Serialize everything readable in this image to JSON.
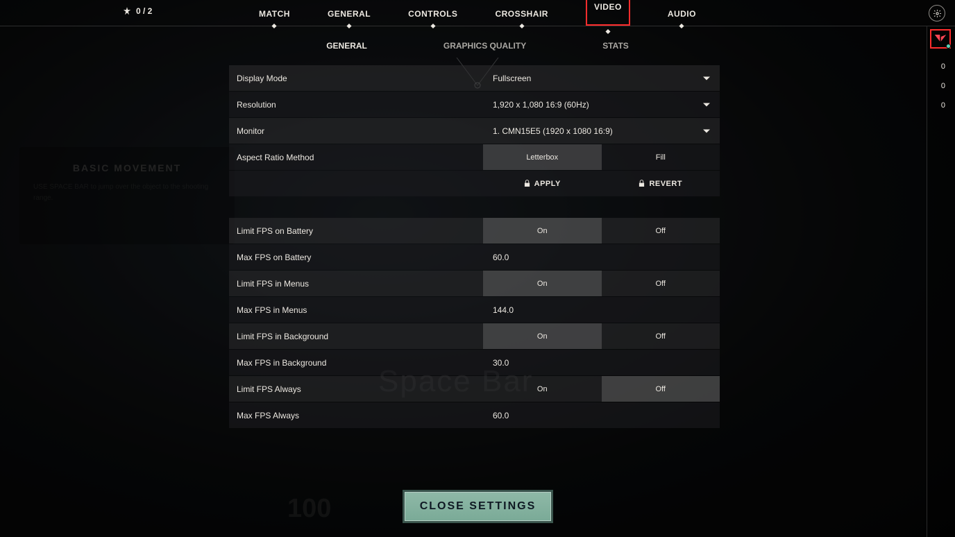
{
  "top": {
    "bolt_count": "0 / 2",
    "tabs": [
      "MATCH",
      "GENERAL",
      "CONTROLS",
      "CROSSHAIR",
      "VIDEO",
      "AUDIO"
    ],
    "active_index": 4,
    "sub_tabs": [
      "GENERAL",
      "GRAPHICS QUALITY",
      "STATS"
    ],
    "sub_active_index": 0
  },
  "display": {
    "display_mode_label": "Display Mode",
    "display_mode_value": "Fullscreen",
    "resolution_label": "Resolution",
    "resolution_value": "1,920 x 1,080 16:9 (60Hz)",
    "monitor_label": "Monitor",
    "monitor_value": "1. CMN15E5 (1920 x  1080 16:9)",
    "aspect_label": "Aspect Ratio Method",
    "aspect_options": {
      "left": "Letterbox",
      "right": "Fill"
    },
    "aspect_selected": "left",
    "apply_label": "APPLY",
    "revert_label": "REVERT"
  },
  "fps": {
    "limit_battery_label": "Limit FPS on Battery",
    "limit_battery_selected": "left",
    "max_battery_label": "Max FPS on Battery",
    "max_battery_value": "60.0",
    "limit_menus_label": "Limit FPS in Menus",
    "limit_menus_selected": "left",
    "max_menus_label": "Max FPS in Menus",
    "max_menus_value": "144.0",
    "limit_bg_label": "Limit FPS in Background",
    "limit_bg_selected": "left",
    "max_bg_label": "Max FPS in Background",
    "max_bg_value": "30.0",
    "limit_always_label": "Limit FPS Always",
    "limit_always_selected": "right",
    "max_always_label": "Max FPS Always",
    "max_always_value": "60.0",
    "on_label": "On",
    "off_label": "Off"
  },
  "close_label": "CLOSE SETTINGS",
  "sidebar": {
    "nums": [
      "0",
      "0",
      "0"
    ]
  },
  "bg": {
    "hint_title": "BASIC MOVEMENT",
    "hint_body": "USE SPACE BAR to jump over the object to the shooting range.",
    "spacebar": "Space Bar",
    "hp": "100"
  }
}
